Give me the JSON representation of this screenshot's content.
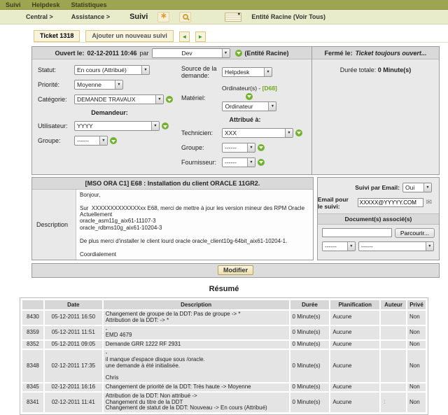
{
  "colors": {
    "topbar": "#9ea550",
    "breadcrumb_bar": "#e9ecca",
    "accent_green": "#72b32d",
    "link_green": "#72a81d",
    "tab_border": "#d9c77c",
    "panel_gray": "#e9e9e9"
  },
  "menubar": {
    "items": [
      "Suivi",
      "Helpdesk",
      "Statistiques"
    ]
  },
  "breadcrumb": {
    "items": [
      "Central >",
      "Assistance >"
    ],
    "current": "Suivi",
    "entity": "Entité Racine (Voir Tous)"
  },
  "tabs": {
    "ticket": "Ticket 1318",
    "add_followup": "Ajouter un nouveau suivi",
    "prev_arrow": "◄",
    "next_arrow": "►"
  },
  "ticket": {
    "opened_label": "Ouvert le:",
    "opened_date": "02-12-2011 10:46",
    "par_label": "par",
    "owner": "Dev",
    "entity_note": "(Entité Racine)",
    "closed_label": "Fermé le:",
    "closed_value": "Ticket toujours ouvert...",
    "duration_label": "Durée totale:",
    "duration_value": "0 Minute(s)",
    "fields": {
      "statut_label": "Statut:",
      "statut_value": "En cours (Attribué)",
      "priorite_label": "Priorité:",
      "priorite_value": "Moyenne",
      "categorie_label": "Catégorie:",
      "categorie_value": "DEMANDE TRAVAUX",
      "demandeur_header": "Demandeur:",
      "utilisateur_label": "Utilisateur:",
      "utilisateur_value": "YYYY",
      "groupe_label": "Groupe:",
      "groupe_value": "------",
      "source_label": "Source de la demande:",
      "source_value": "Helpdesk",
      "materiel_label": "Matériel:",
      "materiel_link_prefix": "Ordinateur(s) - ",
      "materiel_link": "[D68]",
      "materiel_value": "Ordinateur",
      "attribue_header": "Attribué à:",
      "technicien_label": "Technicien:",
      "technicien_value": "XXX",
      "groupe2_label": "Groupe:",
      "groupe2_value": "------",
      "fournisseur_label": "Fournisseur:",
      "fournisseur_value": "------"
    },
    "title": "[MSO ORA C1] E68 : Installation du client ORACLE 11GR2.",
    "description_label": "Description",
    "description_text": "Bonjour,\n\nSur  XXXXXXXXXXXXXxx E68, merci de mettre à jour les version mineur des RPM Oracle\nActuellement\noracle_asm11g_aix61-11107-3\noracle_rdbms10g_aix61-10204-3\n\nDe plus merci d'installer le client lourd oracle oracle_client10g-64bit_aix61-10204-1.\n\nCoordialement",
    "email": {
      "suivi_label": "Suivi par Email:",
      "suivi_value": "Oui",
      "email_label": "Email pour le suivi:",
      "email_value": "XXXXX@YYYYY.COM"
    },
    "documents": {
      "header": "Document(s) associé(s)",
      "browse_label": "Parcourir...",
      "select1": "------",
      "select2": "------"
    },
    "modify_button": "Modifier"
  },
  "summary": {
    "heading": "Résumé",
    "columns": [
      "",
      "Date",
      "Description",
      "Durée",
      "Planification",
      "Auteur",
      "Privé"
    ],
    "rows": [
      {
        "id": "8430",
        "date": "05-12-2011 16:50",
        "description": "Changement de groupe de la DDT: Pas de groupe -> *\nAttribution de la DDT: -> *",
        "duree": "0 Minute(s)",
        "planification": "Aucune",
        "auteur": "",
        "prive": "Non"
      },
      {
        "id": "8359",
        "date": "05-12-2011 11:51",
        "description": "-\nEMD 4679",
        "duree": "0 Minute(s)",
        "planification": "Aucune",
        "auteur": "",
        "prive": "Non"
      },
      {
        "id": "8352",
        "date": "05-12-2011 09:05",
        "description": "Demande GRR 1222 RF 2931",
        "duree": "0 Minute(s)",
        "planification": "Aucune",
        "auteur": "",
        "prive": "Non"
      },
      {
        "id": "8348",
        "date": "02-12-2011 17:35",
        "description": "-\nil manque d'espace disque sous /oracle.\nune demande à été initialisée.\n\nChris",
        "duree": "0 Minute(s)",
        "planification": "Aucune",
        "auteur": "",
        "prive": "Non"
      },
      {
        "id": "8345",
        "date": "02-12-2011 16:16",
        "description": "Changement de priorité de la DDT: Très haute -> Moyenne",
        "duree": "0 Minute(s)",
        "planification": "Aucune",
        "auteur": "",
        "prive": "Non"
      },
      {
        "id": "8341",
        "date": "02-12-2011 11:41",
        "description": "Attribution de la DDT: Non attribué ->\nChangement du titre de la DDT\nChangement de statut de la DDT: Nouveau -> En cours (Attribué)",
        "duree": "0 Minute(s)",
        "planification": "Aucune",
        "auteur": "1",
        "prive": "Non"
      }
    ]
  }
}
